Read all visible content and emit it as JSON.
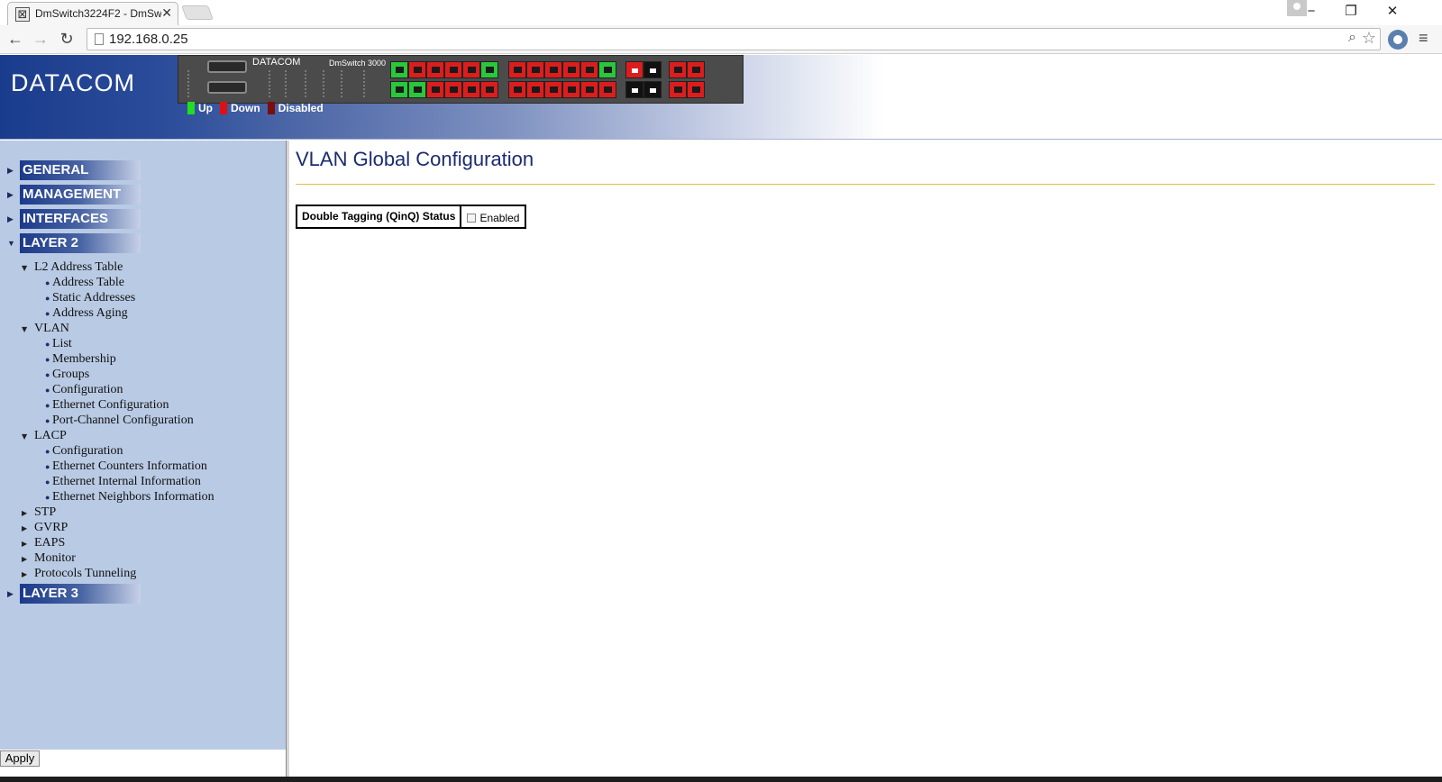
{
  "browser": {
    "tab_title": "DmSwitch3224F2 - DmSw",
    "tab_close": "✕",
    "url": "192.168.0.25",
    "win_minimize": "−",
    "win_restore": "❐",
    "win_close": "✕"
  },
  "header": {
    "logo": "DATACOM",
    "panel_brand": "DATACOM",
    "panel_model": "DmSwitch 3000",
    "legend": [
      {
        "label": "Up",
        "color": "#22dd22"
      },
      {
        "label": "Down",
        "color": "#e01010"
      },
      {
        "label": "Disabled",
        "color": "#7a0d0d"
      }
    ],
    "ports_top_group1": [
      "up",
      "down",
      "down",
      "down",
      "down",
      "up"
    ],
    "ports_top_group2": [
      "down",
      "down",
      "down",
      "down",
      "down",
      "up"
    ],
    "ports_bottom_group1": [
      "up",
      "up",
      "down",
      "down",
      "down",
      "down"
    ],
    "ports_bottom_group2": [
      "down",
      "down",
      "down",
      "down",
      "down",
      "down"
    ]
  },
  "sidebar": {
    "sections": [
      {
        "label": "GENERAL",
        "expanded": false
      },
      {
        "label": "MANAGEMENT",
        "expanded": false
      },
      {
        "label": "INTERFACES",
        "expanded": false
      },
      {
        "label": "LAYER 2",
        "expanded": true
      },
      {
        "label": "LAYER 3",
        "expanded": false
      }
    ],
    "layer2_tree": {
      "l2_address_table": "L2 Address Table",
      "address_table": "Address Table",
      "static_addresses": "Static Addresses",
      "address_aging": "Address Aging",
      "vlan": "VLAN",
      "vlan_list": "List",
      "vlan_membership": "Membership",
      "vlan_groups": "Groups",
      "vlan_configuration": "Configuration",
      "vlan_ethernet_configuration": "Ethernet Configuration",
      "vlan_port_channel_configuration": "Port-Channel Configuration",
      "lacp": "LACP",
      "lacp_configuration": "Configuration",
      "lacp_ethernet_counters": "Ethernet Counters Information",
      "lacp_ethernet_internal": "Ethernet Internal Information",
      "lacp_ethernet_neighbors": "Ethernet Neighbors Information",
      "stp": "STP",
      "gvrp": "GVRP",
      "eaps": "EAPS",
      "monitor": "Monitor",
      "protocols_tunneling": "Protocols Tunneling"
    },
    "apply_label": "Apply"
  },
  "main": {
    "title": "VLAN Global Configuration",
    "qinq_label": "Double Tagging (QinQ) Status",
    "qinq_option": "Enabled",
    "qinq_checked": false
  }
}
